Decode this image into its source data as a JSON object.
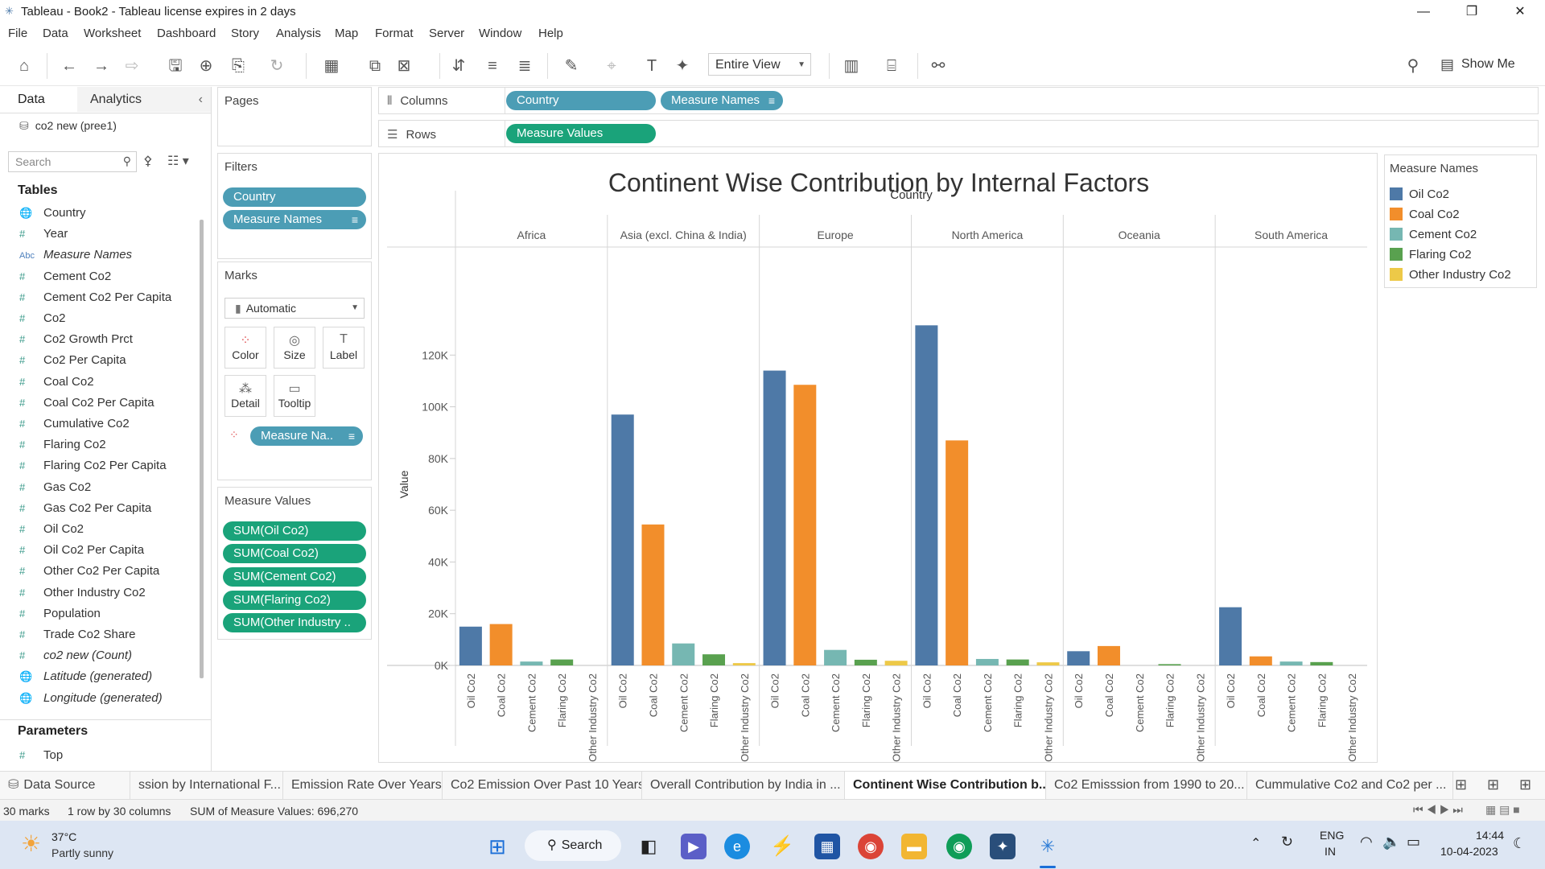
{
  "window": {
    "title": "Tableau - Book2 - Tableau license expires in 2 days"
  },
  "menu": [
    "File",
    "Data",
    "Worksheet",
    "Dashboard",
    "Story",
    "Analysis",
    "Map",
    "Format",
    "Server",
    "Window",
    "Help"
  ],
  "toolbar": {
    "fit": "Entire View",
    "show_me": "Show Me"
  },
  "datapane": {
    "tab_data": "Data",
    "tab_analytics": "Analytics",
    "datasource": "co2 new (pree1)",
    "search_placeholder": "Search",
    "tables_label": "Tables",
    "fields": [
      {
        "icon": "globe",
        "name": "Country",
        "italic": false
      },
      {
        "icon": "#",
        "name": "Year",
        "italic": false
      },
      {
        "icon": "Abc",
        "name": "Measure Names",
        "italic": true
      },
      {
        "icon": "#",
        "name": "Cement Co2",
        "italic": false
      },
      {
        "icon": "#",
        "name": "Cement Co2 Per Capita",
        "italic": false
      },
      {
        "icon": "#",
        "name": "Co2",
        "italic": false
      },
      {
        "icon": "#",
        "name": "Co2 Growth Prct",
        "italic": false
      },
      {
        "icon": "#",
        "name": "Co2 Per Capita",
        "italic": false
      },
      {
        "icon": "#",
        "name": "Coal Co2",
        "italic": false
      },
      {
        "icon": "#",
        "name": "Coal Co2 Per Capita",
        "italic": false
      },
      {
        "icon": "#",
        "name": "Cumulative Co2",
        "italic": false
      },
      {
        "icon": "#",
        "name": "Flaring Co2",
        "italic": false
      },
      {
        "icon": "#",
        "name": "Flaring Co2 Per Capita",
        "italic": false
      },
      {
        "icon": "#",
        "name": "Gas Co2",
        "italic": false
      },
      {
        "icon": "#",
        "name": "Gas Co2 Per Capita",
        "italic": false
      },
      {
        "icon": "#",
        "name": "Oil Co2",
        "italic": false
      },
      {
        "icon": "#",
        "name": "Oil Co2 Per Capita",
        "italic": false
      },
      {
        "icon": "#",
        "name": "Other Co2 Per Capita",
        "italic": false
      },
      {
        "icon": "#",
        "name": "Other Industry Co2",
        "italic": false
      },
      {
        "icon": "#",
        "name": "Population",
        "italic": false
      },
      {
        "icon": "#",
        "name": "Trade Co2 Share",
        "italic": false
      },
      {
        "icon": "#",
        "name": "co2 new (Count)",
        "italic": true
      },
      {
        "icon": "globe",
        "name": "Latitude (generated)",
        "italic": true
      },
      {
        "icon": "globe",
        "name": "Longitude (generated)",
        "italic": true
      }
    ],
    "parameters_label": "Parameters",
    "parameters": [
      {
        "icon": "#",
        "name": "Top"
      }
    ]
  },
  "shelves": {
    "pages": "Pages",
    "columns_label": "Columns",
    "columns": [
      "Country",
      "Measure Names"
    ],
    "rows_label": "Rows",
    "rows": [
      "Measure Values"
    ],
    "filters_label": "Filters",
    "filters": [
      "Country",
      "Measure Names"
    ],
    "marks_label": "Marks",
    "marks_type": "Automatic",
    "mark_buttons": [
      "Color",
      "Size",
      "Label",
      "Detail",
      "Tooltip"
    ],
    "color_pill": "Measure Na..",
    "measure_values_label": "Measure Values",
    "measure_values": [
      "SUM(Oil Co2)",
      "SUM(Coal Co2)",
      "SUM(Cement Co2)",
      "SUM(Flaring Co2)",
      "SUM(Other Industry .."
    ]
  },
  "legend": {
    "title": "Measure Names",
    "items": [
      {
        "name": "Oil Co2",
        "color": "#4e79a7"
      },
      {
        "name": "Coal Co2",
        "color": "#f28e2b"
      },
      {
        "name": "Cement Co2",
        "color": "#76b7b2"
      },
      {
        "name": "Flaring Co2",
        "color": "#59a14f"
      },
      {
        "name": "Other Industry Co2",
        "color": "#edc948"
      }
    ]
  },
  "chart_data": {
    "type": "bar",
    "title": "Continent Wise Contribution by Internal Factors",
    "column_header": "Country",
    "ylabel": "Value",
    "ylim": [
      0,
      140000
    ],
    "yticks": [
      0,
      20000,
      40000,
      60000,
      80000,
      100000,
      120000
    ],
    "ytick_labels": [
      "0K",
      "20K",
      "40K",
      "60K",
      "80K",
      "100K",
      "120K"
    ],
    "groups": [
      "Africa",
      "Asia (excl. China & India)",
      "Europe",
      "North America",
      "Oceania",
      "South America"
    ],
    "categories": [
      "Oil Co2",
      "Coal Co2",
      "Cement Co2",
      "Flaring Co2",
      "Other Industry Co2"
    ],
    "series": [
      {
        "name": "Oil Co2",
        "values": [
          15000,
          97000,
          114000,
          131500,
          5500,
          22500
        ]
      },
      {
        "name": "Coal Co2",
        "values": [
          16000,
          54500,
          108500,
          87000,
          7500,
          3500
        ]
      },
      {
        "name": "Cement Co2",
        "values": [
          1500,
          8500,
          6000,
          2500,
          0,
          1500
        ]
      },
      {
        "name": "Flaring Co2",
        "values": [
          2300,
          4300,
          2200,
          2300,
          500,
          1300
        ]
      },
      {
        "name": "Other Industry Co2",
        "values": [
          0,
          900,
          1800,
          1200,
          0,
          0
        ]
      }
    ],
    "grid": false
  },
  "sheet_tabs": {
    "data_source": "Data Source",
    "tabs": [
      "ssion by International F...",
      "Emission Rate Over Years",
      "Co2 Emission  Over Past 10 Years",
      "Overall Contribution by India in ...",
      "Continent Wise Contribution b...",
      "Co2 Emisssion from 1990 to 20...",
      "Cummulative Co2 and Co2 per ..."
    ],
    "active_index": 4
  },
  "status": {
    "marks": "30 marks",
    "grid": "1 row by 30 columns",
    "sum": "SUM of Measure Values: 696,270"
  },
  "taskbar": {
    "weather_temp": "37°C",
    "weather_desc": "Partly sunny",
    "search": "Search",
    "lang1": "ENG",
    "lang2": "IN",
    "time": "14:44",
    "date": "10-04-2023"
  }
}
